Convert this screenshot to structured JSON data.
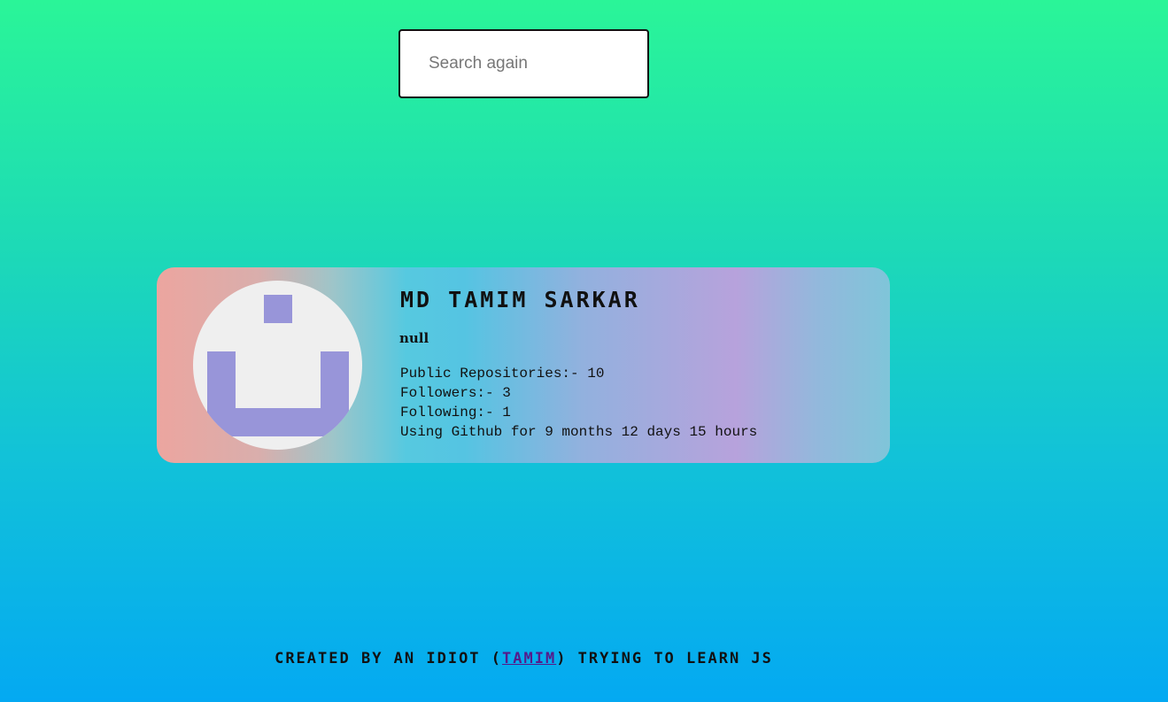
{
  "search": {
    "placeholder": "Search again",
    "value": ""
  },
  "profile": {
    "name": "MD Tamim Sarkar",
    "bio": "null",
    "stats": [
      {
        "label": "Public Repositories:- 10"
      },
      {
        "label": "Followers:- 3"
      },
      {
        "label": "Following:- 1"
      },
      {
        "label": "Using Github for 9 months 12 days 15 hours"
      }
    ],
    "avatar_icon": "identicon-avatar"
  },
  "footer": {
    "prefix": "Created by an idiot (",
    "link_text": "Tamim",
    "suffix": ") trying to learn JS"
  },
  "colors": {
    "background_top": "#2af598",
    "background_bottom": "#04a9f2",
    "avatar_blocks": "#9895d9",
    "link": "#551a8b"
  }
}
